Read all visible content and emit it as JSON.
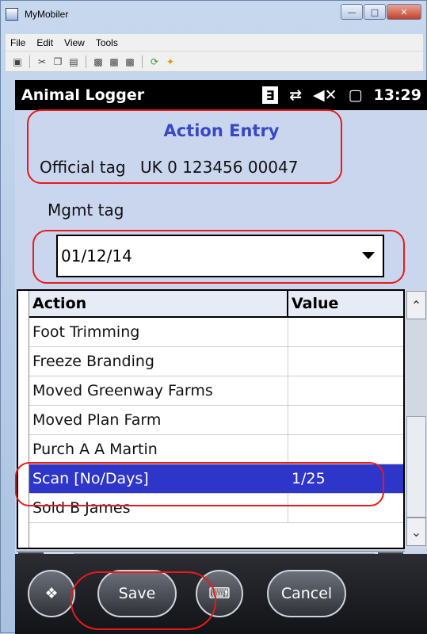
{
  "window": {
    "title": "MyMobiler",
    "menu": [
      "File",
      "Edit",
      "View",
      "Tools"
    ],
    "toolbar_icons": [
      "device-icon",
      "cut-icon",
      "copy-icon",
      "paste-icon",
      "capture-icon",
      "capture2-icon",
      "capture3-icon",
      "rotate-icon",
      "clean-icon"
    ]
  },
  "status": {
    "app_name": "Animal Logger",
    "time": "13:29",
    "icons": [
      "bluetooth-icon",
      "connection-icon",
      "volume-icon",
      "battery-icon"
    ]
  },
  "form": {
    "title": "Action Entry",
    "official_tag_label": "Official tag",
    "official_tag_value": "UK 0 123456 00047",
    "mgmt_tag_label": "Mgmt tag",
    "date_value": "01/12/14"
  },
  "grid": {
    "columns": [
      "Action",
      "Value"
    ],
    "rows": [
      {
        "action": "Foot Trimming",
        "value": ""
      },
      {
        "action": "Freeze Branding",
        "value": ""
      },
      {
        "action": "Moved Greenway Farms",
        "value": ""
      },
      {
        "action": "Moved Plan Farm",
        "value": ""
      },
      {
        "action": "Purch A A Martin",
        "value": ""
      },
      {
        "action": "Scan [No/Days]",
        "value": "1/25",
        "selected": true
      },
      {
        "action": "Sold B James",
        "value": ""
      }
    ]
  },
  "buttons": {
    "save": "Save",
    "cancel": "Cancel"
  },
  "colors": {
    "accent": "#3848c2",
    "selection": "#2e35c9",
    "annotation": "#e81a1a"
  }
}
